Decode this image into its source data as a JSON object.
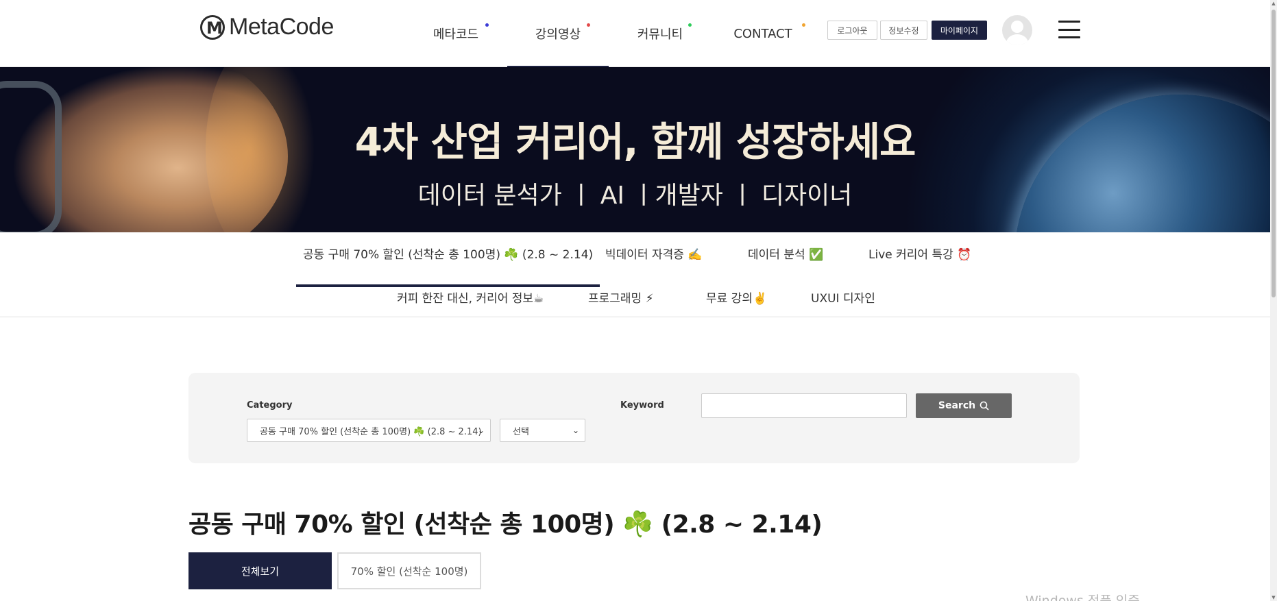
{
  "brand": {
    "name": "MetaCode",
    "mark": "M"
  },
  "nav": {
    "items": [
      {
        "label": "메타코드",
        "dot_color": "#3b3bd6"
      },
      {
        "label": "강의영상",
        "dot_color": "#e24848"
      },
      {
        "label": "커뮤니티",
        "dot_color": "#2ecc5b"
      },
      {
        "label": "CONTACT",
        "dot_color": "#f0a430"
      }
    ],
    "active_index": 1
  },
  "account": {
    "logout": "로그아웃",
    "edit_info": "정보수정",
    "mypage": "마이페이지"
  },
  "hero": {
    "title": "4차 산업 커리어, 함께 성장하세요",
    "subtitle": "데이터 분석가 ㅣ AI ㅣ개발자 ㅣ 디자이너"
  },
  "category_tabs": [
    "공동 구매 70% 할인 (선착순 총 100명) ☘️ (2.8 ~ 2.14)",
    "빅데이터 자격증 ✍️",
    "데이터 분석 ✅",
    "Live 커리어 특강 ⏰",
    "커피 한잔 대신, 커리어 정보☕",
    "프로그래밍 ⚡",
    "무료 강의✌️",
    "UXUI 디자인"
  ],
  "search": {
    "category_label": "Category",
    "category_value": "공동 구매 70% 할인 (선착순 총 100명) ☘️ (2.8 ~ 2.14)",
    "sub_value": "선택",
    "keyword_label": "Keyword",
    "keyword_value": "",
    "button_label": "Search"
  },
  "section": {
    "title": "공동 구매 70% 할인 (선착순 총 100명) ☘️ (2.8 ~ 2.14)",
    "filters": [
      "전체보기",
      "70% 할인 (선착순 100명)"
    ]
  },
  "watermark": "Windows 정품 인증",
  "colors": {
    "navy": "#1c2140",
    "panel": "#f4f4f4",
    "search_button": "#676767"
  }
}
